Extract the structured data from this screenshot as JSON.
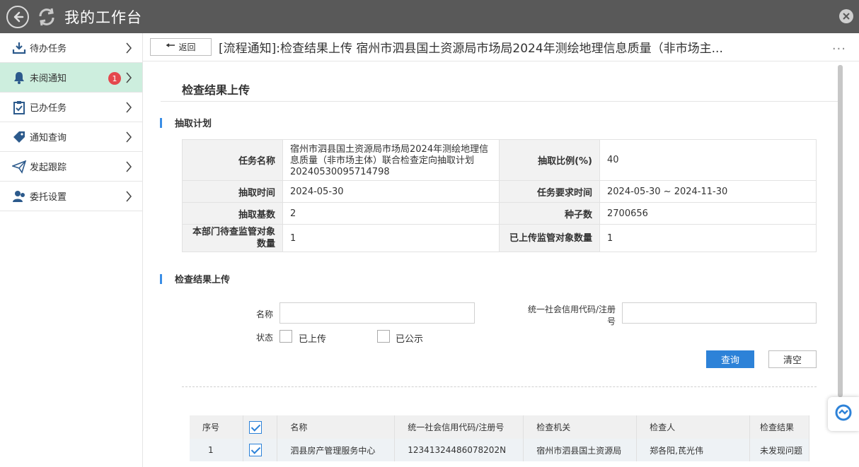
{
  "app": {
    "title": "我的工作台"
  },
  "sidebar": {
    "items": [
      {
        "label": "待办任务",
        "icon": "inbox-download-icon"
      },
      {
        "label": "未阅通知",
        "icon": "bell-icon",
        "badge": "1"
      },
      {
        "label": "已办任务",
        "icon": "clipboard-check-icon"
      },
      {
        "label": "通知查询",
        "icon": "tag-icon"
      },
      {
        "label": "发起跟踪",
        "icon": "paper-plane-icon"
      },
      {
        "label": "委托设置",
        "icon": "user-delegate-icon"
      }
    ]
  },
  "header": {
    "back_label": "返回",
    "title": "[流程通知]:检查结果上传 宿州市泗县国土资源局市场局2024年测绘地理信息质量（非市场主...",
    "more": "···"
  },
  "page": {
    "title": "检查结果上传",
    "plan_section": "抽取计划",
    "upload_section": "检查结果上传"
  },
  "plan": {
    "task_name_label": "任务名称",
    "task_name_value": "宿州市泗县国土资源局市场局2024年测绘地理信息质量（非市场主体）联合检查定向抽取计划20240530095714798",
    "ratio_label": "抽取比例(%)",
    "ratio_value": "40",
    "time_label": "抽取时间",
    "time_value": "2024-05-30",
    "req_time_label": "任务要求时间",
    "req_time_value": "2024-05-30 ~ 2024-11-30",
    "base_label": "抽取基数",
    "base_value": "2",
    "seed_label": "种子数",
    "seed_value": "2700656",
    "dept_pending_label": "本部门待查监管对象数量",
    "dept_pending_value": "1",
    "uploaded_label": "已上传监管对象数量",
    "uploaded_value": "1"
  },
  "search": {
    "name_label": "名称",
    "name_value": "",
    "credit_label": "统一社会信用代码/注册号",
    "credit_value": "",
    "status_label": "状态",
    "status_uploaded": "已上传",
    "status_published": "已公示",
    "query_button": "查询",
    "clear_button": "清空"
  },
  "grid": {
    "headers": [
      "序号",
      "",
      "名称",
      "统一社会信用代码/注册号",
      "检查机关",
      "检查人",
      "检查结果"
    ],
    "rows": [
      {
        "index": "1",
        "name": "泗县房产管理服务中心",
        "code": "12341324486078202N",
        "agency": "宿州市泗县国土资源局",
        "inspector": "郑各阳,芪光伟",
        "result": "未发现问题"
      }
    ]
  },
  "colors": {
    "accent": "#2d82d8",
    "topbar": "#595959",
    "active_nav": "#cdeede",
    "badge": "#e5484d"
  }
}
